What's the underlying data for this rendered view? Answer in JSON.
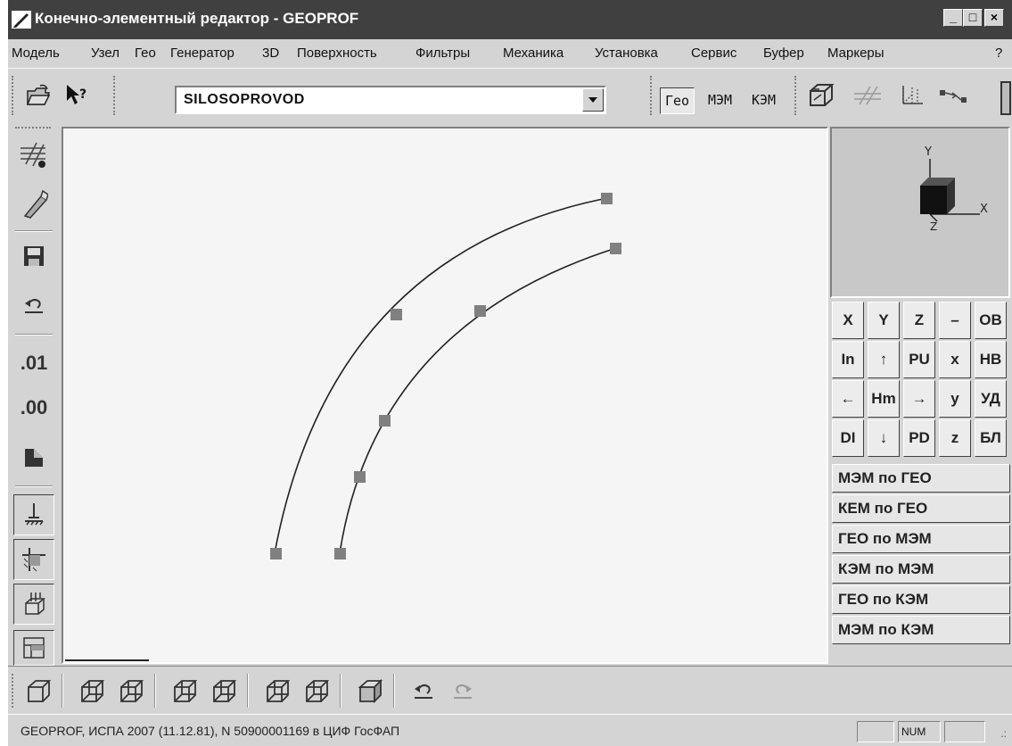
{
  "window": {
    "title": "Конечно-элементный редактор - GEOPROF",
    "minimize_label": "_",
    "maximize_label": "□",
    "close_label": "×"
  },
  "menu": {
    "items": [
      "Модель",
      "Узел",
      "Гео",
      "Генератор",
      "3D",
      "Поверхность",
      "Фильтры",
      "Механика",
      "Установка",
      "Сервис",
      "Буфер",
      "Маркеры",
      "?"
    ]
  },
  "toolbar": {
    "model_select_value": "SILOSOPROVOD",
    "modes": [
      "Гео",
      "МЭМ",
      "КЭМ"
    ],
    "active_mode": "Гео"
  },
  "left_toolbar": {
    "precision_more": ".01",
    "precision_less": ".00"
  },
  "view_axes": {
    "y": "Y",
    "x": "X",
    "z": "Z"
  },
  "keypad": {
    "rows": [
      [
        "X",
        "Y",
        "Z",
        "–",
        "OB"
      ],
      [
        "In",
        "↑",
        "PU",
        "x",
        "HB"
      ],
      [
        "←",
        "Hm",
        "→",
        "y",
        "УД"
      ],
      [
        "DI",
        "↓",
        "PD",
        "z",
        "БЛ"
      ]
    ]
  },
  "convert_buttons": [
    "МЭМ по ГЕО",
    "КЕМ по ГЕО",
    "ГЕО по МЭМ",
    "КЭМ по МЭМ",
    "ГЕО по КЭМ",
    "МЭМ по КЭМ"
  ],
  "status": {
    "text": "GEOPROF, ИСПА 2007 (11.12.81), N 50900001169 в ЦИФ ГосФАП",
    "num_indicator": "NUM"
  },
  "icons": {
    "title": "pencil-icon",
    "open": "open-folder-icon",
    "help": "context-help-icon"
  },
  "colors": {
    "titlebar": "#404040",
    "canvas": "#f5f5f5",
    "node": "#808080"
  }
}
